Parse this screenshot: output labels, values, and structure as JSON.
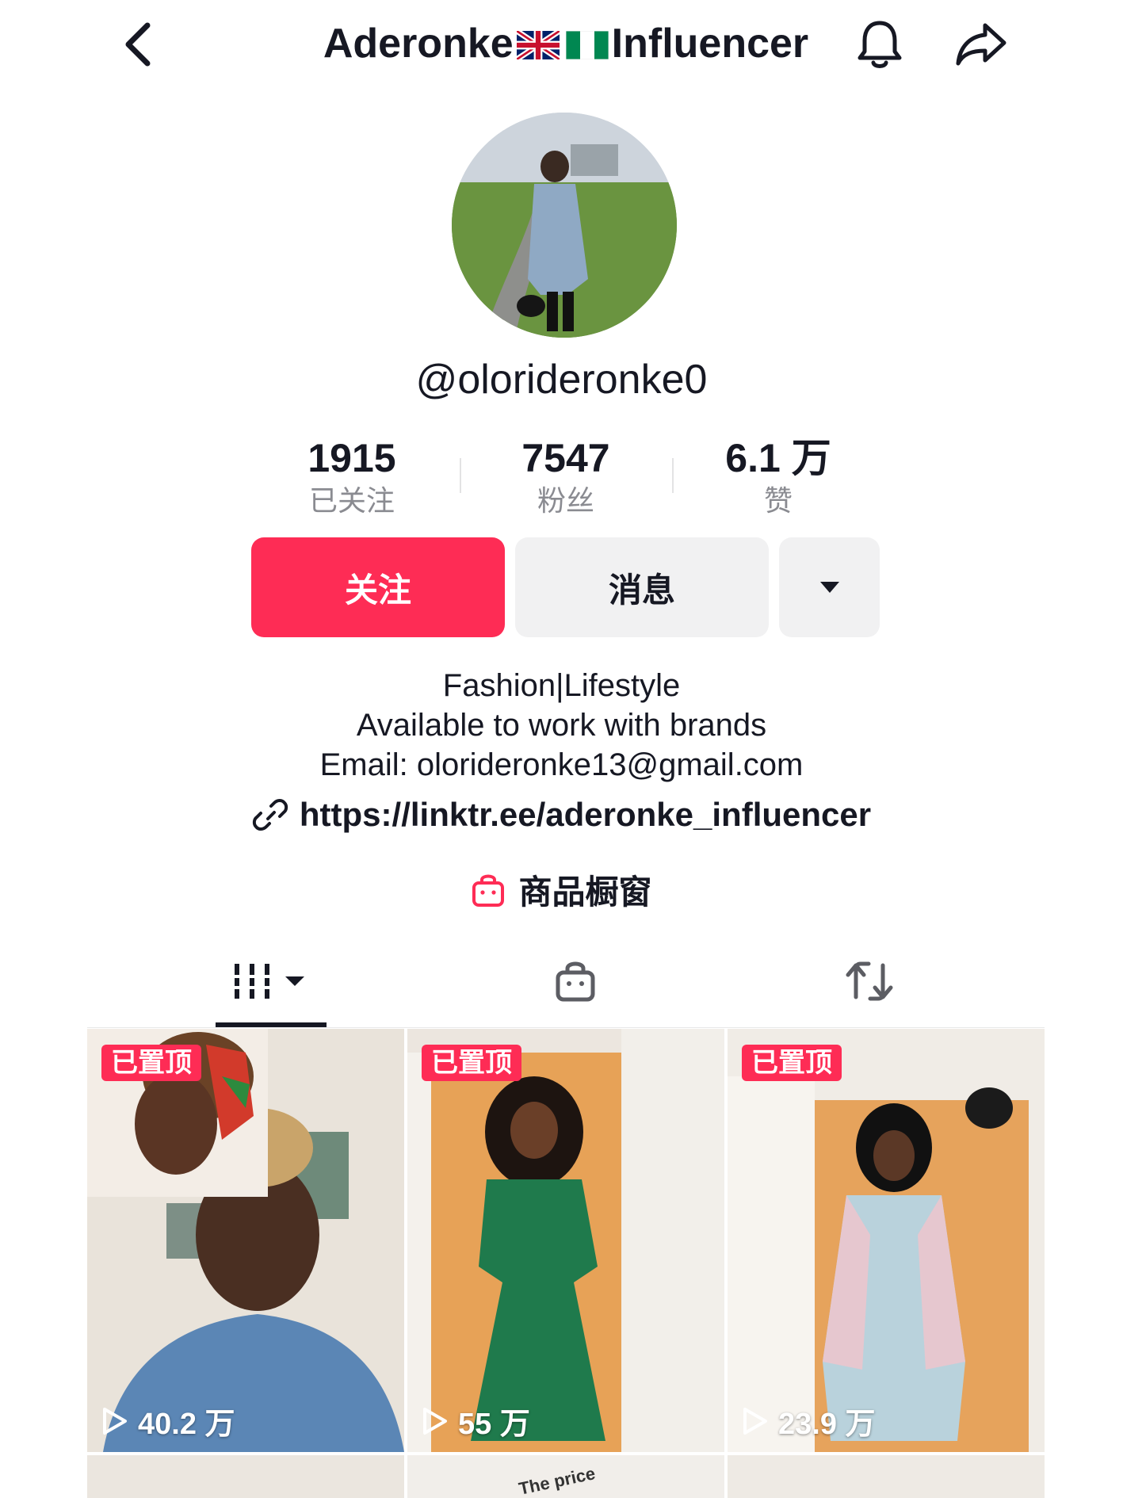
{
  "header": {
    "title_left": "Aderonke",
    "title_right": "Influencer",
    "icons": [
      "back-arrow-icon",
      "bell-icon",
      "share-arrow-icon",
      "uk-flag-icon",
      "nigeria-flag-icon"
    ]
  },
  "profile": {
    "handle": "@olorideronke0",
    "stats": [
      {
        "value": "1915",
        "label": "已关注"
      },
      {
        "value": "7547",
        "label": "粉丝"
      },
      {
        "value": "6.1 万",
        "label": "赞"
      }
    ],
    "buttons": {
      "follow": "关注",
      "message": "消息"
    },
    "bio": [
      "Fashion|Lifestyle",
      "Available to work with brands",
      "Email: olorideronke13@gmail.com"
    ],
    "link": "https://linktr.ee/aderonke_influencer",
    "shop_label": "商品橱窗"
  },
  "tabs": {
    "icons": [
      "videos-grid-icon",
      "shopping-bag-icon",
      "repost-icon"
    ]
  },
  "videos": [
    {
      "pin_label": "已置顶",
      "views": "40.2 万"
    },
    {
      "pin_label": "已置顶",
      "views": "55 万"
    },
    {
      "pin_label": "已置顶",
      "views": "23.9 万"
    }
  ],
  "row2": {
    "caption_fragment": "The price"
  },
  "colors": {
    "accent": "#fe2c55",
    "secondary_button": "#f1f1f2",
    "muted_text": "#8a8b91"
  }
}
